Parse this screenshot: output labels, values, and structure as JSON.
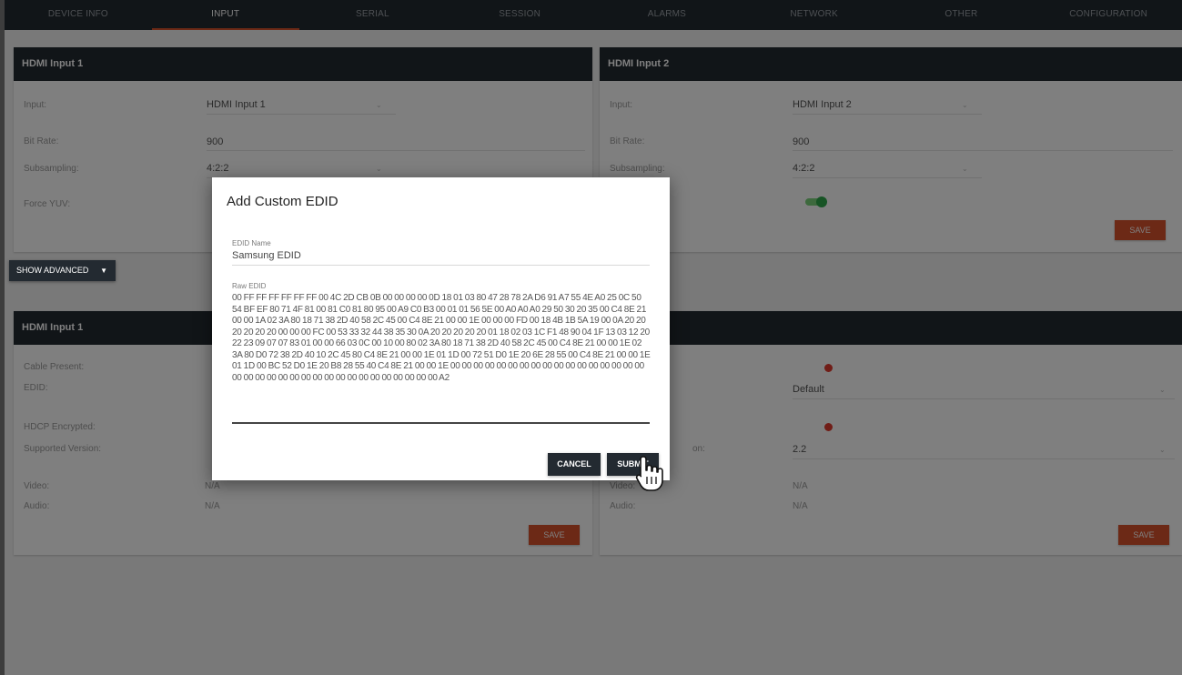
{
  "nav": {
    "tabs": [
      "DEVICE INFO",
      "INPUT",
      "SERIAL",
      "SESSION",
      "ALARMS",
      "NETWORK",
      "OTHER",
      "CONFIGURATION"
    ],
    "active": "INPUT"
  },
  "card1": {
    "title": "HDMI Input 1",
    "input_label": "Input:",
    "input_value": "HDMI Input 1",
    "bitrate_label": "Bit Rate:",
    "bitrate_value": "900",
    "subsampling_label": "Subsampling:",
    "subsampling_value": "4:2:2",
    "forceyuv_label": "Force YUV:"
  },
  "card2": {
    "title": "HDMI Input 2",
    "input_label": "Input:",
    "input_value": "HDMI Input 2",
    "bitrate_label": "Bit Rate:",
    "bitrate_value": "900",
    "subsampling_label": "Subsampling:",
    "subsampling_value": "4:2:2",
    "save_label": "SAVE"
  },
  "advanced_button": "SHOW ADVANCED",
  "card3": {
    "title": "HDMI Input 1",
    "cable_label": "Cable Present:",
    "edid_label": "EDID:",
    "hdcp_label": "HDCP Encrypted:",
    "supported_label": "Supported Version:",
    "video_label": "Video:",
    "video_value": "N/A",
    "audio_label": "Audio:",
    "audio_value": "N/A",
    "save_label": "SAVE"
  },
  "card4": {
    "edid_value": "Default",
    "supported_label_partial": "on:",
    "supported_value": "2.2",
    "video_label": "Video:",
    "video_value": "N/A",
    "audio_label": "Audio:",
    "audio_value": "N/A",
    "save_label": "SAVE"
  },
  "modal": {
    "title": "Add Custom EDID",
    "name_label": "EDID Name",
    "name_value": "Samsung EDID",
    "raw_label": "Raw EDID",
    "raw_value": "00 FF FF FF FF FF FF 00 4C 2D CB 0B 00 00 00 00 0D 18 01 03 80 47 28 78 2A D6 91 A7 55 4E A0 25 0C 50 54 BF EF 80 71 4F 81 00 81 C0 81 80 95 00 A9 C0 B3 00 01 01 56 5E 00 A0 A0 A0 29 50 30 20 35 00 C4 8E 21 00 00 1A 02 3A 80 18 71 38 2D 40 58 2C 45 00 C4 8E 21 00 00 1E 00 00 00 FD 00 18 4B 1B 5A 19 00 0A 20 20 20 20 20 20 00 00 00 FC 00 53 33 32 44 38 35 30 0A 20 20 20 20 20 01 18 02 03 1C F1 48 90 04 1F 13 03 12 20 22 23 09 07 07 83 01 00 00 66 03 0C 00 10 00 80 02 3A 80 18 71 38 2D 40 58 2C 45 00 C4 8E 21 00 00 1E 02 3A 80 D0 72 38 2D 40 10 2C 45 80 C4 8E 21 00 00 1E 01 1D 00 72 51 D0 1E 20 6E 28 55 00 C4 8E 21 00 00 1E 01 1D 00 BC 52 D0 1E 20 B8 28 55 40 C4 8E 21 00 00 1E 00 00 00 00 00 00 00 00 00 00 00 00 00 00 00 00 00 00 00 00 00 00 00 00 00 00 00 00 00 00 00 00 00 00 00 A2",
    "cancel_label": "CANCEL",
    "submit_label": "SUBMIT"
  }
}
